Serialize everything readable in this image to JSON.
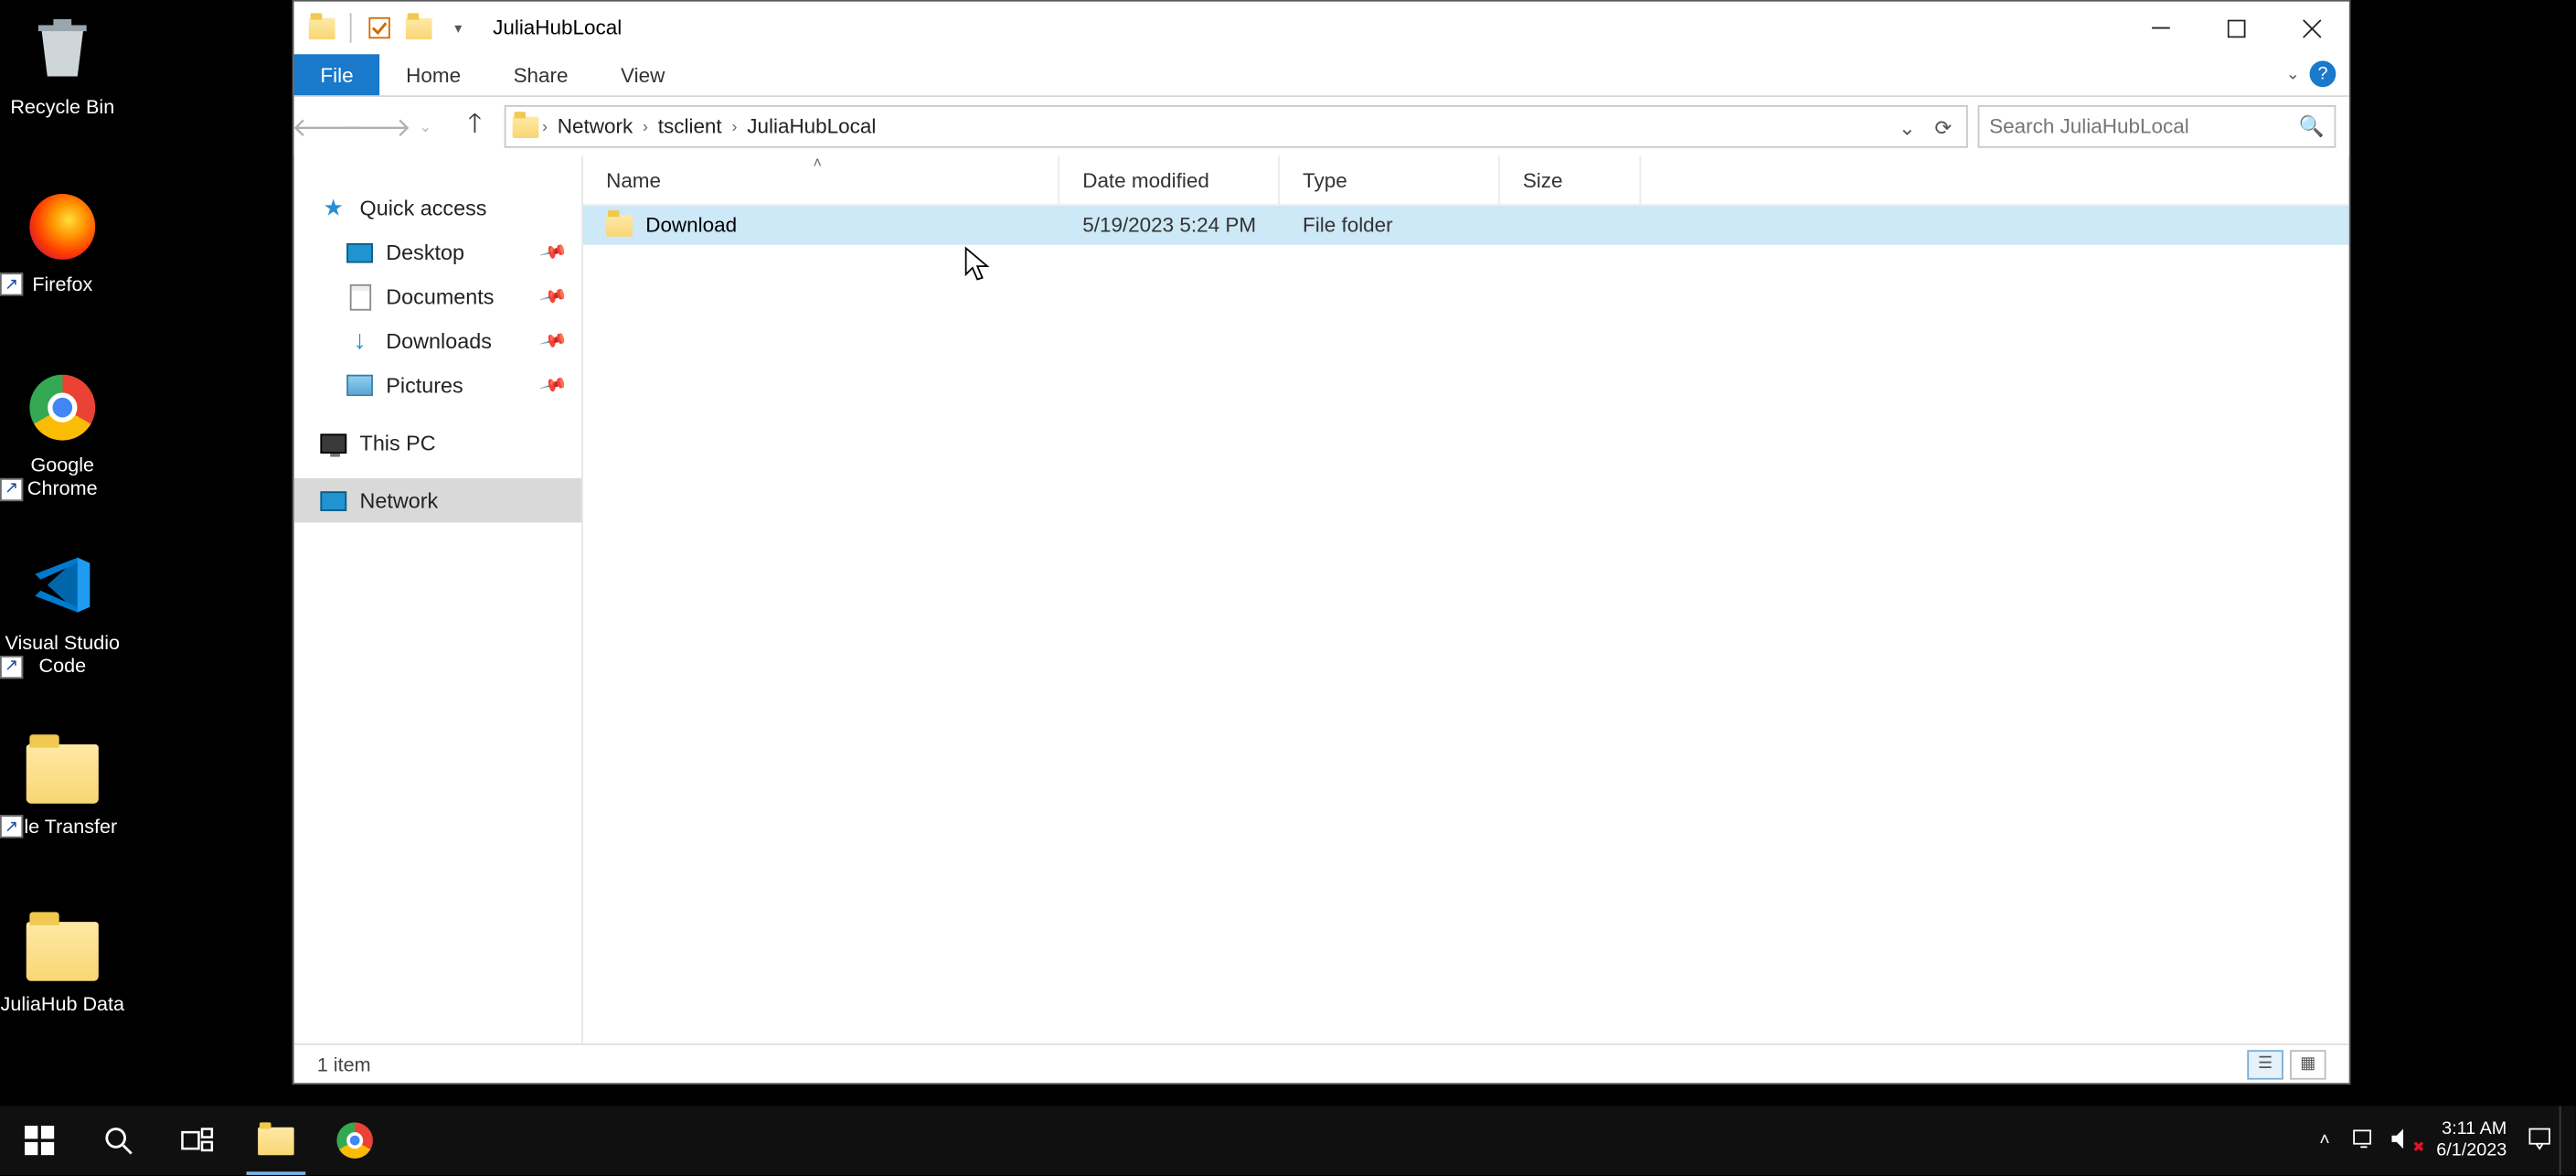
{
  "desktop_icons": {
    "recycle": "Recycle Bin",
    "firefox": "Firefox",
    "chrome": "Google Chrome",
    "vscode": "Visual Studio Code",
    "file_transfer": "File Transfer",
    "juliahub_data": "JuliaHub Data"
  },
  "window": {
    "title": "JuliaHubLocal",
    "tabs": {
      "file": "File",
      "home": "Home",
      "share": "Share",
      "view": "View"
    },
    "breadcrumb": {
      "root": "Network",
      "mid": "tsclient",
      "leaf": "JuliaHubLocal"
    },
    "search_placeholder": "Search JuliaHubLocal",
    "columns": {
      "name": "Name",
      "date": "Date modified",
      "type": "Type",
      "size": "Size"
    },
    "rows": [
      {
        "name": "Download",
        "date": "5/19/2023 5:24 PM",
        "type": "File folder",
        "size": ""
      }
    ],
    "status": "1 item"
  },
  "navpane": {
    "quick_access": "Quick access",
    "desktop": "Desktop",
    "documents": "Documents",
    "downloads": "Downloads",
    "pictures": "Pictures",
    "this_pc": "This PC",
    "network": "Network"
  },
  "taskbar": {
    "time": "3:11 AM",
    "date": "6/1/2023"
  }
}
